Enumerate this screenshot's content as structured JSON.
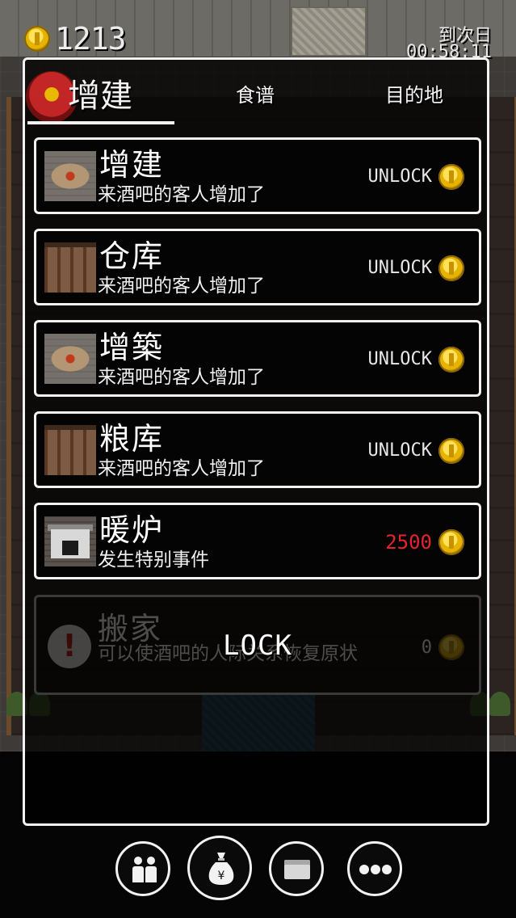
{
  "hud": {
    "money": "1213",
    "next_day_label": "到次日",
    "timer": "00:58:11"
  },
  "tabs": [
    {
      "label": "增建",
      "active": true
    },
    {
      "label": "食谱",
      "active": false
    },
    {
      "label": "目的地",
      "active": false
    }
  ],
  "items": [
    {
      "title": "增建",
      "desc": "来酒吧的客人增加了",
      "price": "UNLOCK",
      "thumb": "table"
    },
    {
      "title": "仓库",
      "desc": "来酒吧的客人增加了",
      "price": "UNLOCK",
      "thumb": "storeroom"
    },
    {
      "title": "增築",
      "desc": "来酒吧的客人增加了",
      "price": "UNLOCK",
      "thumb": "table"
    },
    {
      "title": "粮库",
      "desc": "来酒吧的客人增加了",
      "price": "UNLOCK",
      "thumb": "granary"
    },
    {
      "title": "暖炉",
      "desc": "发生特别事件",
      "price": "2500",
      "price_color": "#e8242b",
      "thumb": "fireplace"
    }
  ],
  "locked_item": {
    "title": "搬家",
    "desc": "可以使酒吧的人际关系恢复原状",
    "price": "0",
    "lock_label": "LOCK",
    "icon": "exclamation-bubble-icon"
  },
  "nav": [
    {
      "name": "staff",
      "icon": "people-icon"
    },
    {
      "name": "shop",
      "icon": "money-bag-icon",
      "active": true
    },
    {
      "name": "folder",
      "icon": "folder-icon"
    },
    {
      "name": "more",
      "icon": "more-dots-icon"
    }
  ],
  "colors": {
    "panel_border": "#f2f2f2",
    "coin": "#e6b400",
    "price_alert": "#e8242b"
  }
}
